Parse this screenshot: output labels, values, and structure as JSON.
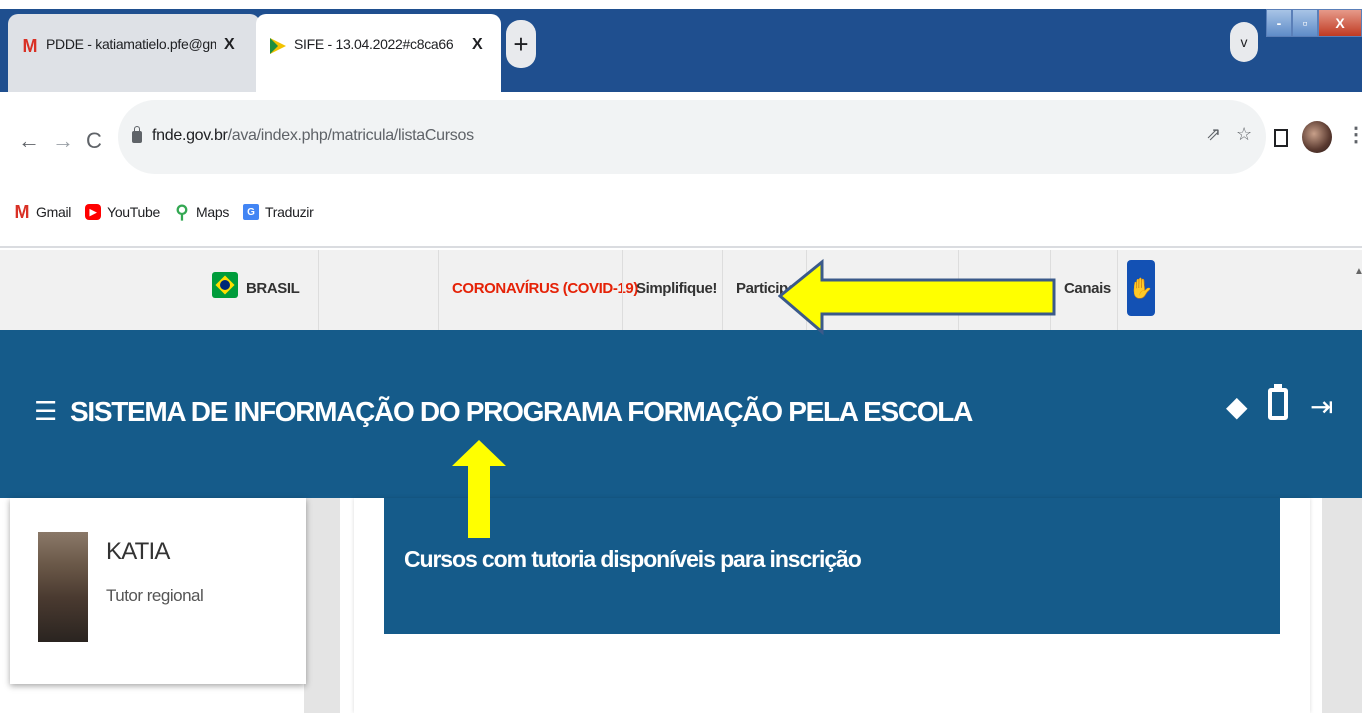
{
  "browser": {
    "tabs": [
      {
        "title": "PDDE - katiamatielo.pfe@gmail.c",
        "favicon": "gmail-icon",
        "active": false
      },
      {
        "title": "SIFE - 13.04.2022#c8ca66",
        "favicon": "gov-br-icon",
        "active": true
      }
    ],
    "new_tab_label": "+",
    "tab_search_label": "v",
    "window_buttons": {
      "minimize": "-",
      "maximize": "▫",
      "close": "X"
    },
    "url": {
      "domain": "fnde.gov.br",
      "path": "/ava/index.php/matricula/listaCursos"
    },
    "bookmarks": [
      {
        "label": "Gmail",
        "icon": "gmail-icon"
      },
      {
        "label": "YouTube",
        "icon": "youtube-icon"
      },
      {
        "label": "Maps",
        "icon": "maps-icon"
      },
      {
        "label": "Traduzir",
        "icon": "translate-icon"
      }
    ]
  },
  "govbar": {
    "brasil": "BRASIL",
    "corona": "CORONAVÍRUS (COVID-19)",
    "simplifique": "Simplifique!",
    "participe": "Participe",
    "canais": "Canais"
  },
  "header": {
    "title": "SISTEMA DE INFORMAÇÃO DO PROGRAMA FORMAÇÃO PELA ESCOLA"
  },
  "user": {
    "name": "KATIA",
    "role": "Tutor regional"
  },
  "main": {
    "card_title": "Cursos com tutoria disponíveis para inscrição"
  },
  "colors": {
    "brand_blue": "#155b8a",
    "chrome_frame": "#1f4f8f",
    "covid_red": "#e52207",
    "annotation_yellow": "#ffff00"
  }
}
